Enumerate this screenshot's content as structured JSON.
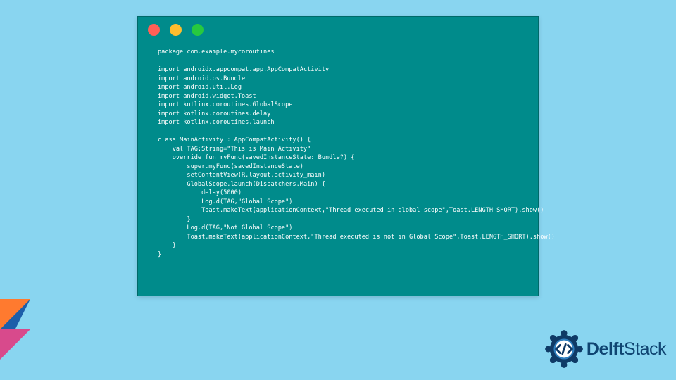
{
  "window": {
    "dots": [
      "red",
      "yellow",
      "green"
    ]
  },
  "code": {
    "lines": [
      "package com.example.mycoroutines",
      "",
      "import androidx.appcompat.app.AppCompatActivity",
      "import android.os.Bundle",
      "import android.util.Log",
      "import android.widget.Toast",
      "import kotlinx.coroutines.GlobalScope",
      "import kotlinx.coroutines.delay",
      "import kotlinx.coroutines.launch",
      "",
      "class MainActivity : AppCompatActivity() {",
      "    val TAG:String=\"This is Main Activity\"",
      "    override fun myFunc(savedInstanceState: Bundle?) {",
      "        super.myFunc(savedInstanceState)",
      "        setContentView(R.layout.activity_main)",
      "        GlobalScope.launch(Dispatchers.Main) {",
      "            delay(5000)",
      "            Log.d(TAG,\"Global Scope\")",
      "            Toast.makeText(applicationContext,\"Thread executed in global scope\",Toast.LENGTH_SHORT).show()",
      "        }",
      "        Log.d(TAG,\"Not Global Scope\")",
      "        Toast.makeText(applicationContext,\"Thread executed is not in Global Scope\",Toast.LENGTH_SHORT).show()",
      "    }",
      "}"
    ]
  },
  "branding": {
    "name_part1": "Delft",
    "name_part2": "Stack"
  },
  "colors": {
    "page_bg": "#89d5f0",
    "window_bg": "#008b8b",
    "code_text": "#ffffff",
    "dot_red": "#ff5f56",
    "dot_yellow": "#ffbd2e",
    "dot_green": "#27c93f",
    "logo_primary": "#0f3a66",
    "logo_accent": "#2f7fbf"
  }
}
